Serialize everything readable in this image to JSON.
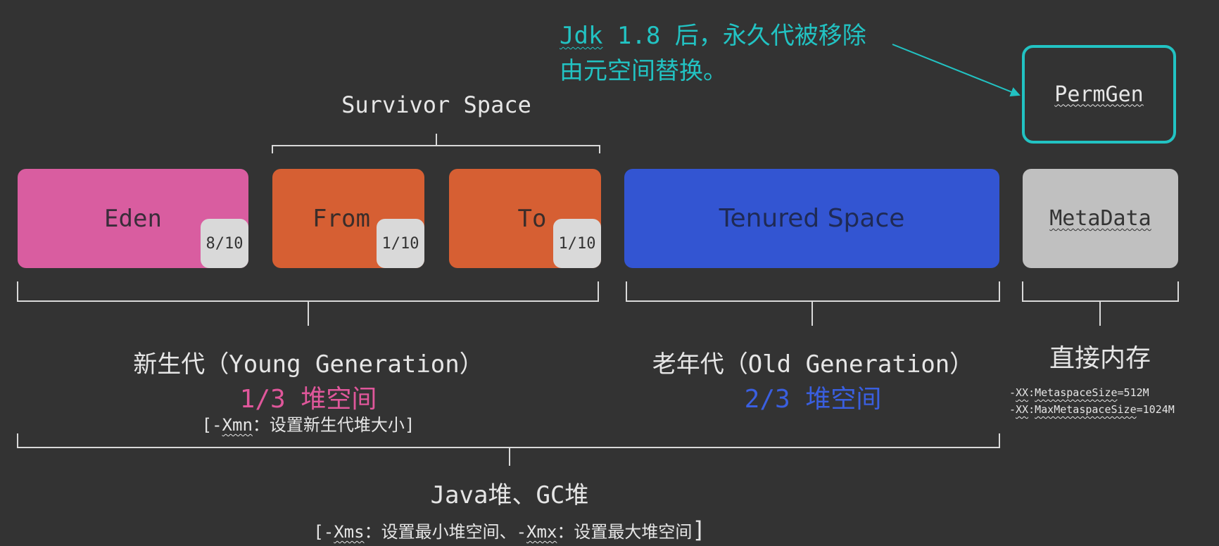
{
  "note": {
    "line1_part_jdk": "Jdk",
    "line1_rest": " 1.8 后，永久代被移除",
    "line2": "由元空间替换。"
  },
  "survivor_label": "Survivor Space",
  "boxes": {
    "eden": {
      "label": "Eden",
      "ratio": "8/10",
      "color": "#d95da0"
    },
    "from": {
      "label": "From",
      "ratio": "1/10",
      "color": "#d65f33"
    },
    "to": {
      "label": "To",
      "ratio": "1/10",
      "color": "#d65f33"
    },
    "tenured": {
      "label": "Tenured Space",
      "color": "#3355d2"
    },
    "metadata": {
      "label": "MetaData",
      "color": "#c0c0c0"
    },
    "permgen": {
      "label": "PermGen",
      "border_color": "#22c3c3"
    }
  },
  "young": {
    "title": "新生代（Young Generation）",
    "fraction": "1/3 堆空间",
    "param_open": "[-",
    "param_flag": "Xmn",
    "param_rest": "：设置新生代堆大小]"
  },
  "old": {
    "title": "老年代（Old Generation）",
    "fraction": "2/3 堆空间"
  },
  "direct": {
    "title": "直接内存",
    "param1_flag": "XX",
    "param1_name": "MetaspaceSize",
    "param1_value": "=512M",
    "param2_flag": "XX",
    "param2_name": "MaxMetaspaceSize",
    "param2_value": "=1024M"
  },
  "heap": {
    "title": "Java堆、GC堆",
    "param_open": "[-",
    "param_xms": "Xms",
    "param_mid": "：设置最小堆空间、-",
    "param_xmx": "Xmx",
    "param_end": "：设置最大堆空间"
  },
  "colors": {
    "background": "#333333",
    "young_accent": "#e0579b",
    "old_accent": "#3a5fe0",
    "note_teal": "#22c3c3",
    "bracket_line": "#d9d9d9"
  }
}
